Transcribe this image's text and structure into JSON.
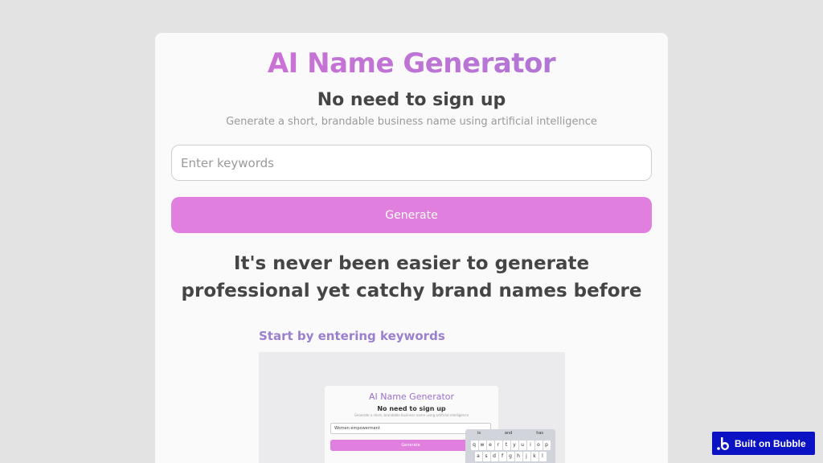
{
  "header": {
    "title": "AI Name Generator",
    "subtitle": "No need to sign up",
    "tagline": "Generate a short, brandable business name using artificial intelligence"
  },
  "form": {
    "keywords_placeholder": "Enter keywords",
    "keywords_value": "",
    "generate_label": "Generate"
  },
  "promo": {
    "headline": "It's never been easier to generate professional yet catchy brand names before",
    "step_label": "Start by entering keywords"
  },
  "preview": {
    "title": "AI Name Generator",
    "subtitle": "No need to sign up",
    "tagline": "Generate a short, brandable business name using artificial intelligence",
    "input_value": "Women empowerment",
    "button_label": "Generate",
    "keyboard_suggestions": [
      "is",
      "and",
      "has"
    ],
    "keyboard_row1": [
      "q",
      "w",
      "e",
      "r",
      "t",
      "y",
      "u",
      "i",
      "o",
      "p"
    ],
    "keyboard_row2": [
      "a",
      "s",
      "d",
      "f",
      "g",
      "h",
      "j",
      "k",
      "l"
    ]
  },
  "badge": {
    "label": "Built on Bubble",
    "icon": "bubble-logo-icon"
  },
  "colors": {
    "page_bg": "#e3e3e3",
    "card_bg": "#fafafa",
    "accent_pink": "#e17fde",
    "accent_purple": "#9b7fcf",
    "badge_blue": "#0b12c4"
  }
}
